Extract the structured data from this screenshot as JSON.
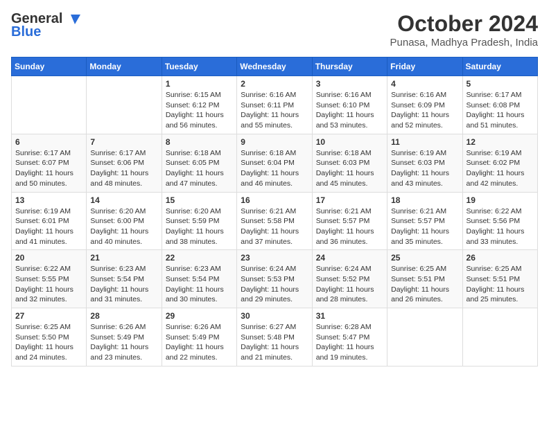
{
  "logo": {
    "general": "General",
    "blue": "Blue"
  },
  "title": "October 2024",
  "location": "Punasa, Madhya Pradesh, India",
  "weekdays": [
    "Sunday",
    "Monday",
    "Tuesday",
    "Wednesday",
    "Thursday",
    "Friday",
    "Saturday"
  ],
  "weeks": [
    [
      {
        "day": "",
        "info": ""
      },
      {
        "day": "",
        "info": ""
      },
      {
        "day": "1",
        "sunrise": "Sunrise: 6:15 AM",
        "sunset": "Sunset: 6:12 PM",
        "daylight": "Daylight: 11 hours and 56 minutes."
      },
      {
        "day": "2",
        "sunrise": "Sunrise: 6:16 AM",
        "sunset": "Sunset: 6:11 PM",
        "daylight": "Daylight: 11 hours and 55 minutes."
      },
      {
        "day": "3",
        "sunrise": "Sunrise: 6:16 AM",
        "sunset": "Sunset: 6:10 PM",
        "daylight": "Daylight: 11 hours and 53 minutes."
      },
      {
        "day": "4",
        "sunrise": "Sunrise: 6:16 AM",
        "sunset": "Sunset: 6:09 PM",
        "daylight": "Daylight: 11 hours and 52 minutes."
      },
      {
        "day": "5",
        "sunrise": "Sunrise: 6:17 AM",
        "sunset": "Sunset: 6:08 PM",
        "daylight": "Daylight: 11 hours and 51 minutes."
      }
    ],
    [
      {
        "day": "6",
        "sunrise": "Sunrise: 6:17 AM",
        "sunset": "Sunset: 6:07 PM",
        "daylight": "Daylight: 11 hours and 50 minutes."
      },
      {
        "day": "7",
        "sunrise": "Sunrise: 6:17 AM",
        "sunset": "Sunset: 6:06 PM",
        "daylight": "Daylight: 11 hours and 48 minutes."
      },
      {
        "day": "8",
        "sunrise": "Sunrise: 6:18 AM",
        "sunset": "Sunset: 6:05 PM",
        "daylight": "Daylight: 11 hours and 47 minutes."
      },
      {
        "day": "9",
        "sunrise": "Sunrise: 6:18 AM",
        "sunset": "Sunset: 6:04 PM",
        "daylight": "Daylight: 11 hours and 46 minutes."
      },
      {
        "day": "10",
        "sunrise": "Sunrise: 6:18 AM",
        "sunset": "Sunset: 6:03 PM",
        "daylight": "Daylight: 11 hours and 45 minutes."
      },
      {
        "day": "11",
        "sunrise": "Sunrise: 6:19 AM",
        "sunset": "Sunset: 6:03 PM",
        "daylight": "Daylight: 11 hours and 43 minutes."
      },
      {
        "day": "12",
        "sunrise": "Sunrise: 6:19 AM",
        "sunset": "Sunset: 6:02 PM",
        "daylight": "Daylight: 11 hours and 42 minutes."
      }
    ],
    [
      {
        "day": "13",
        "sunrise": "Sunrise: 6:19 AM",
        "sunset": "Sunset: 6:01 PM",
        "daylight": "Daylight: 11 hours and 41 minutes."
      },
      {
        "day": "14",
        "sunrise": "Sunrise: 6:20 AM",
        "sunset": "Sunset: 6:00 PM",
        "daylight": "Daylight: 11 hours and 40 minutes."
      },
      {
        "day": "15",
        "sunrise": "Sunrise: 6:20 AM",
        "sunset": "Sunset: 5:59 PM",
        "daylight": "Daylight: 11 hours and 38 minutes."
      },
      {
        "day": "16",
        "sunrise": "Sunrise: 6:21 AM",
        "sunset": "Sunset: 5:58 PM",
        "daylight": "Daylight: 11 hours and 37 minutes."
      },
      {
        "day": "17",
        "sunrise": "Sunrise: 6:21 AM",
        "sunset": "Sunset: 5:57 PM",
        "daylight": "Daylight: 11 hours and 36 minutes."
      },
      {
        "day": "18",
        "sunrise": "Sunrise: 6:21 AM",
        "sunset": "Sunset: 5:57 PM",
        "daylight": "Daylight: 11 hours and 35 minutes."
      },
      {
        "day": "19",
        "sunrise": "Sunrise: 6:22 AM",
        "sunset": "Sunset: 5:56 PM",
        "daylight": "Daylight: 11 hours and 33 minutes."
      }
    ],
    [
      {
        "day": "20",
        "sunrise": "Sunrise: 6:22 AM",
        "sunset": "Sunset: 5:55 PM",
        "daylight": "Daylight: 11 hours and 32 minutes."
      },
      {
        "day": "21",
        "sunrise": "Sunrise: 6:23 AM",
        "sunset": "Sunset: 5:54 PM",
        "daylight": "Daylight: 11 hours and 31 minutes."
      },
      {
        "day": "22",
        "sunrise": "Sunrise: 6:23 AM",
        "sunset": "Sunset: 5:54 PM",
        "daylight": "Daylight: 11 hours and 30 minutes."
      },
      {
        "day": "23",
        "sunrise": "Sunrise: 6:24 AM",
        "sunset": "Sunset: 5:53 PM",
        "daylight": "Daylight: 11 hours and 29 minutes."
      },
      {
        "day": "24",
        "sunrise": "Sunrise: 6:24 AM",
        "sunset": "Sunset: 5:52 PM",
        "daylight": "Daylight: 11 hours and 28 minutes."
      },
      {
        "day": "25",
        "sunrise": "Sunrise: 6:25 AM",
        "sunset": "Sunset: 5:51 PM",
        "daylight": "Daylight: 11 hours and 26 minutes."
      },
      {
        "day": "26",
        "sunrise": "Sunrise: 6:25 AM",
        "sunset": "Sunset: 5:51 PM",
        "daylight": "Daylight: 11 hours and 25 minutes."
      }
    ],
    [
      {
        "day": "27",
        "sunrise": "Sunrise: 6:25 AM",
        "sunset": "Sunset: 5:50 PM",
        "daylight": "Daylight: 11 hours and 24 minutes."
      },
      {
        "day": "28",
        "sunrise": "Sunrise: 6:26 AM",
        "sunset": "Sunset: 5:49 PM",
        "daylight": "Daylight: 11 hours and 23 minutes."
      },
      {
        "day": "29",
        "sunrise": "Sunrise: 6:26 AM",
        "sunset": "Sunset: 5:49 PM",
        "daylight": "Daylight: 11 hours and 22 minutes."
      },
      {
        "day": "30",
        "sunrise": "Sunrise: 6:27 AM",
        "sunset": "Sunset: 5:48 PM",
        "daylight": "Daylight: 11 hours and 21 minutes."
      },
      {
        "day": "31",
        "sunrise": "Sunrise: 6:28 AM",
        "sunset": "Sunset: 5:47 PM",
        "daylight": "Daylight: 11 hours and 19 minutes."
      },
      {
        "day": "",
        "info": ""
      },
      {
        "day": "",
        "info": ""
      }
    ]
  ]
}
